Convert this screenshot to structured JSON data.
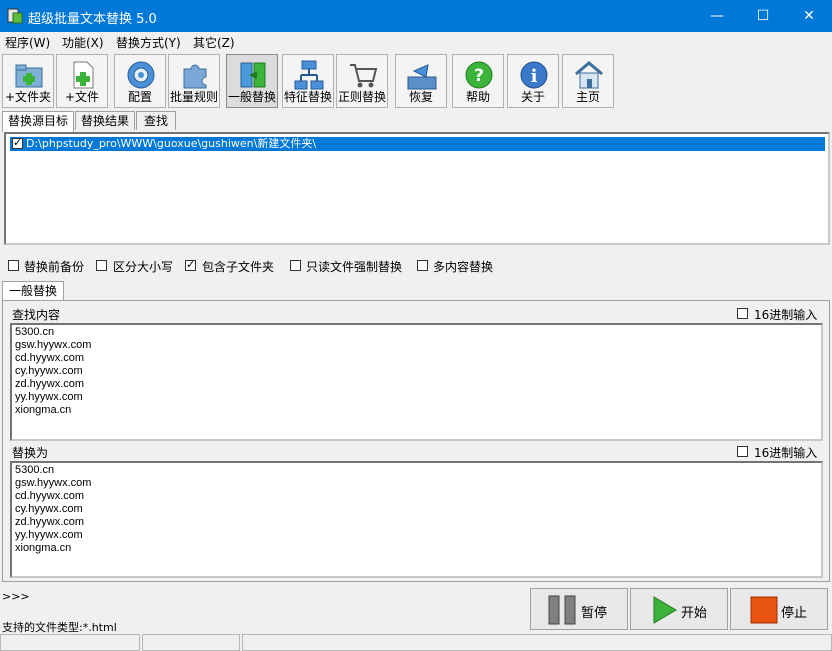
{
  "window": {
    "title": "超级批量文本替换 5.0",
    "minimize": "—",
    "maximize": "☐",
    "close": "✕"
  },
  "menu": [
    "程序(W)",
    "功能(X)",
    "替换方式(Y)",
    "其它(Z)"
  ],
  "toolbar": {
    "add_folder": "+文件夹",
    "add_file": "+文件",
    "config": "配置",
    "batch_rules": "批量规则",
    "general_replace": "一般替换",
    "feature_replace": "特征替换",
    "regex_replace": "正则替换",
    "restore": "恢复",
    "help": "帮助",
    "about": "关于",
    "home": "主页"
  },
  "top_tabs": [
    "替换源目标",
    "替换结果",
    "查找"
  ],
  "targets": [
    {
      "checked": true,
      "path": "D:\\phpstudy_pro\\WWW\\guoxue\\gushiwen\\新建文件夹\\"
    }
  ],
  "options": [
    {
      "label": "替换前备份",
      "checked": false
    },
    {
      "label": "区分大小写",
      "checked": false
    },
    {
      "label": "包含子文件夹",
      "checked": true
    },
    {
      "label": "只读文件强制替换",
      "checked": false
    },
    {
      "label": "多内容替换",
      "checked": false
    }
  ],
  "mode_tab": "一般替换",
  "find": {
    "label": "查找内容",
    "hex_label": "16进制输入",
    "lines": [
      "5300.cn",
      "gsw.hyywx.com",
      "cd.hyywx.com",
      "cy.hyywx.com",
      "zd.hyywx.com",
      "yy.hyywx.com",
      "xiongma.cn"
    ]
  },
  "replace": {
    "label": "替换为",
    "hex_label": "16进制输入",
    "lines": [
      "5300.cn",
      "gsw.hyywx.com",
      "cd.hyywx.com",
      "cy.hyywx.com",
      "zd.hyywx.com",
      "yy.hyywx.com",
      "xiongma.cn"
    ]
  },
  "log": {
    "prompt": ">>>",
    "file_types": "支持的文件类型:*.html"
  },
  "buttons": {
    "pause": "暂停",
    "start": "开始",
    "stop": "停止"
  }
}
